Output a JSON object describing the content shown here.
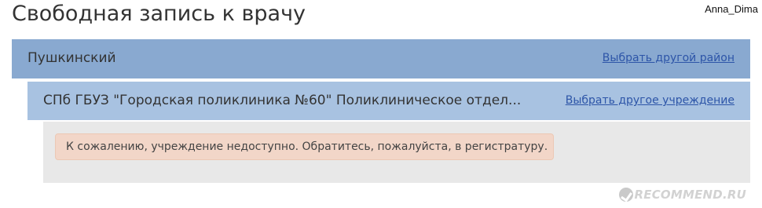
{
  "header": {
    "title": "Свободная запись к врачу",
    "username": "Anna_Dima"
  },
  "district": {
    "name": "Пушкинский",
    "change_link": "Выбрать другой район"
  },
  "institution": {
    "name": "СПб ГБУЗ \"Городская поликлиника №60\" Поликлиническое отдел...",
    "change_link": "Выбрать другое учреждение"
  },
  "alert": {
    "message": "К сожалению, учреждение недоступно. Обратитесь, пожалуйста, в регистратуру."
  },
  "watermark": {
    "text": "RECOMMEND.RU"
  },
  "colors": {
    "district_bar": "#89a9d0",
    "institution_bar": "#a8c2e1",
    "content_panel": "#e8e8e8",
    "alert_bg": "#f2d6c8",
    "link": "#2d55a8"
  }
}
